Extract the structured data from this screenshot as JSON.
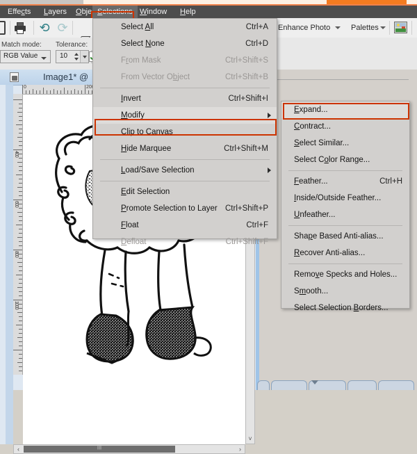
{
  "app": {
    "window_title": "Image1* @"
  },
  "tabstrip": {
    "tabs": [
      {
        "name": "tab-1",
        "active": false
      },
      {
        "name": "tab-2",
        "active": false
      },
      {
        "name": "tab-3",
        "active": false
      },
      {
        "name": "tab-4-active",
        "active": true
      },
      {
        "name": "tab-5",
        "active": false
      }
    ],
    "accent_color": "#f47b20"
  },
  "menubar": {
    "items": [
      {
        "label": "Effects",
        "mnemonic": "c",
        "open": false
      },
      {
        "label": "Layers",
        "mnemonic": "L",
        "open": false
      },
      {
        "label": "Objects",
        "mnemonic": "O",
        "open": false
      },
      {
        "label": "Selections",
        "mnemonic": "S",
        "open": true
      },
      {
        "label": "Window",
        "mnemonic": "W",
        "open": false
      },
      {
        "label": "Help",
        "mnemonic": "H",
        "open": false
      }
    ],
    "highlight_color": "#cc3300"
  },
  "toolbar": {
    "print_tooltip": "Print",
    "undo_tooltip": "Undo",
    "redo_tooltip": "Redo",
    "icons": [
      "printer-icon",
      "undo-icon",
      "redo-icon",
      "cube-icon"
    ],
    "enhance_photo_label": "Enhance Photo",
    "palettes_label": "Palettes",
    "palette_icon": "palette-preview-icon"
  },
  "options_bar": {
    "match_mode_label": "Match mode:",
    "match_mode_value": "RGB Value",
    "tolerance_label": "Tolerance:",
    "tolerance_value": "10",
    "checkbox_checked": true
  },
  "document": {
    "title": "Image1* @",
    "ruler_h_labels": [
      "0",
      "200"
    ],
    "ruler_v_labels": [
      "400",
      "600",
      "800",
      "1000"
    ],
    "canvas_description": "black-and-white line drawing of a sheep-like figure wearing boots"
  },
  "menu_selections": {
    "title": "Selections",
    "items": [
      {
        "label": "Select All",
        "mnemonic": "A",
        "accel": "Ctrl+A",
        "disabled": false,
        "submenu": false,
        "sep_after": false
      },
      {
        "label": "Select None",
        "mnemonic": "N",
        "accel": "Ctrl+D",
        "disabled": false,
        "submenu": false,
        "sep_after": false
      },
      {
        "label": "From Mask",
        "mnemonic": "r",
        "accel": "Ctrl+Shift+S",
        "disabled": true,
        "submenu": false,
        "sep_after": false
      },
      {
        "label": "From Vector Object",
        "mnemonic": "b",
        "accel": "Ctrl+Shift+B",
        "disabled": true,
        "submenu": false,
        "sep_after": true
      },
      {
        "label": "Invert",
        "mnemonic": "I",
        "accel": "Ctrl+Shift+I",
        "disabled": false,
        "submenu": false,
        "sep_after": false
      },
      {
        "label": "Modify",
        "mnemonic": "M",
        "accel": "",
        "disabled": false,
        "submenu": true,
        "sep_after": false,
        "highlighted": true
      },
      {
        "label": "Clip to Canvas",
        "mnemonic": "C",
        "accel": "",
        "disabled": false,
        "submenu": false,
        "sep_after": false
      },
      {
        "label": "Hide Marquee",
        "mnemonic": "H",
        "accel": "Ctrl+Shift+M",
        "disabled": false,
        "submenu": false,
        "sep_after": true
      },
      {
        "label": "Load/Save Selection",
        "mnemonic": "L",
        "accel": "",
        "disabled": false,
        "submenu": true,
        "sep_after": true
      },
      {
        "label": "Edit Selection",
        "mnemonic": "E",
        "accel": "",
        "disabled": false,
        "submenu": false,
        "sep_after": false
      },
      {
        "label": "Promote Selection to Layer",
        "mnemonic": "P",
        "accel": "Ctrl+Shift+P",
        "disabled": false,
        "submenu": false,
        "sep_after": false
      },
      {
        "label": "Float",
        "mnemonic": "F",
        "accel": "Ctrl+F",
        "disabled": false,
        "submenu": false,
        "sep_after": false
      },
      {
        "label": "Defloat",
        "mnemonic": "D",
        "accel": "Ctrl+Shift+F",
        "disabled": true,
        "submenu": false,
        "sep_after": false
      }
    ]
  },
  "menu_modify": {
    "title": "Modify",
    "items": [
      {
        "label": "Expand...",
        "mnemonic": "E",
        "accel": "",
        "disabled": false,
        "sep_after": false,
        "highlighted": true
      },
      {
        "label": "Contract...",
        "mnemonic": "C",
        "accel": "",
        "disabled": false,
        "sep_after": false
      },
      {
        "label": "Select Similar...",
        "mnemonic": "S",
        "accel": "",
        "disabled": false,
        "sep_after": false
      },
      {
        "label": "Select Color Range...",
        "mnemonic": "o",
        "accel": "",
        "disabled": false,
        "sep_after": true
      },
      {
        "label": "Feather...",
        "mnemonic": "F",
        "accel": "Ctrl+H",
        "disabled": false,
        "sep_after": false
      },
      {
        "label": "Inside/Outside Feather...",
        "mnemonic": "I",
        "accel": "",
        "disabled": false,
        "sep_after": false
      },
      {
        "label": "Unfeather...",
        "mnemonic": "U",
        "accel": "",
        "disabled": false,
        "sep_after": true
      },
      {
        "label": "Shape Based Anti-alias...",
        "mnemonic": "p",
        "accel": "",
        "disabled": false,
        "sep_after": false
      },
      {
        "label": "Recover Anti-alias...",
        "mnemonic": "R",
        "accel": "",
        "disabled": false,
        "sep_after": true
      },
      {
        "label": "Remove Specks and Holes...",
        "mnemonic": "v",
        "accel": "",
        "disabled": false,
        "sep_after": false
      },
      {
        "label": "Smooth...",
        "mnemonic": "m",
        "accel": "",
        "disabled": false,
        "sep_after": false
      },
      {
        "label": "Select Selection Borders...",
        "mnemonic": "B",
        "accel": "",
        "disabled": false,
        "sep_after": false
      }
    ]
  },
  "scrollbars": {
    "h_left_arrow": "‹",
    "h_right_arrow": "›",
    "v_down_arrow": "˅"
  }
}
